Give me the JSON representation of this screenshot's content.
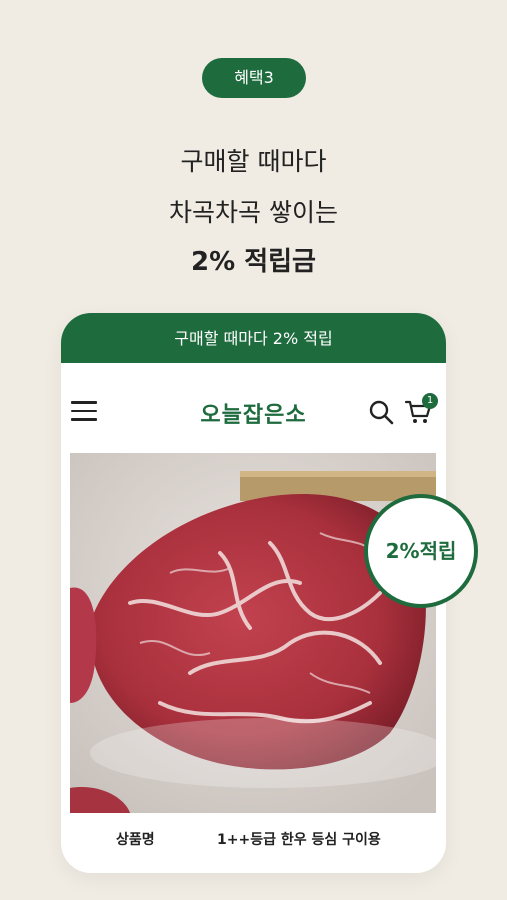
{
  "benefit": {
    "tag": "혜택3"
  },
  "headline": {
    "line1": "구매할 때마다",
    "line2": "차곡차곡 쌓이는",
    "line3": "2% 적립금"
  },
  "phone": {
    "banner": "구매할 때마다 2% 적립",
    "logo": "오늘잡은소",
    "cart_count": "1",
    "badge": "2%적립",
    "product": {
      "label": "상품명",
      "value": "1++등급 한우 등심 구이용"
    }
  },
  "colors": {
    "brand_green": "#1e6b3e",
    "background": "#f1ece3"
  }
}
